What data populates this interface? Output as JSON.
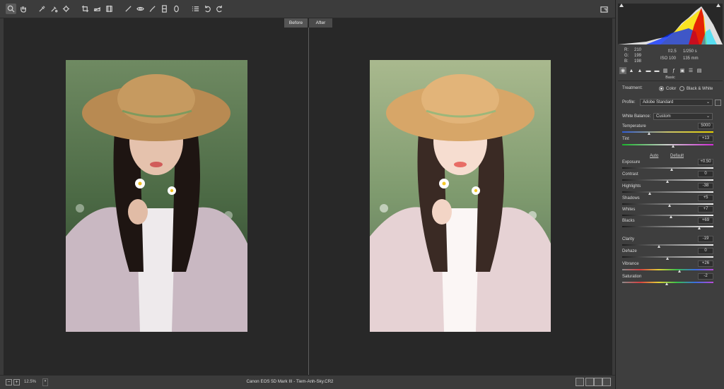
{
  "toolbar": {
    "tools": [
      "zoom-icon",
      "hand-icon",
      "white-balance-icon",
      "color-sampler-icon",
      "target-adjust-icon",
      "crop-icon",
      "straighten-icon",
      "transform-icon",
      "spot-removal-icon",
      "red-eye-icon",
      "adjustment-brush-icon",
      "graduated-filter-icon",
      "radial-filter-icon",
      "presets-list-icon",
      "rotate-left-icon",
      "rotate-right-icon"
    ]
  },
  "view": {
    "before_label": "Before",
    "after_label": "After"
  },
  "status": {
    "zoom": "12.5%",
    "file_info": "Canon EOS 5D Mark III  -  Tiem-Anh-Sky.CR2"
  },
  "histogram": {
    "colors": [
      "#e00000",
      "#ffe400",
      "#0028ff",
      "#00e0ff",
      "#ffffff"
    ]
  },
  "readout": {
    "r_label": "R:",
    "r": "210",
    "g_label": "G:",
    "g": "199",
    "b_label": "B:",
    "b": "198",
    "aperture": "f/2.5",
    "shutter": "1/250 s",
    "iso": "ISO 100",
    "focal": "135 mm"
  },
  "panel": {
    "title": "Basic",
    "treatment_label": "Treatment:",
    "treatment_color": "Color",
    "treatment_bw": "Black & White",
    "profile_label": "Profile:",
    "profile_value": "Adobe Standard",
    "wb_label": "White Balance:",
    "wb_value": "Custom",
    "auto": "Auto",
    "default": "Default"
  },
  "sliders": [
    {
      "name": "Temperature",
      "value": "5000",
      "pos": 0.3,
      "track": "temp"
    },
    {
      "name": "Tint",
      "value": "+13",
      "pos": 0.56,
      "track": "tint"
    },
    {
      "name": "Exposure",
      "value": "+0.50",
      "pos": 0.55,
      "track": "gray"
    },
    {
      "name": "Contrast",
      "value": "0",
      "pos": 0.5,
      "track": "gray"
    },
    {
      "name": "Highlights",
      "value": "-38",
      "pos": 0.31,
      "track": "gray"
    },
    {
      "name": "Shadows",
      "value": "+5",
      "pos": 0.525,
      "track": "gray"
    },
    {
      "name": "Whites",
      "value": "+7",
      "pos": 0.535,
      "track": "gray"
    },
    {
      "name": "Blacks",
      "value": "+69",
      "pos": 0.845,
      "track": "gray"
    },
    {
      "name": "Clarity",
      "value": "-19",
      "pos": 0.405,
      "track": "gray"
    },
    {
      "name": "Dehaze",
      "value": "0",
      "pos": 0.5,
      "track": "gray"
    },
    {
      "name": "Vibrance",
      "value": "+26",
      "pos": 0.63,
      "track": "vib"
    },
    {
      "name": "Saturation",
      "value": "-2",
      "pos": 0.49,
      "track": "sat"
    }
  ]
}
